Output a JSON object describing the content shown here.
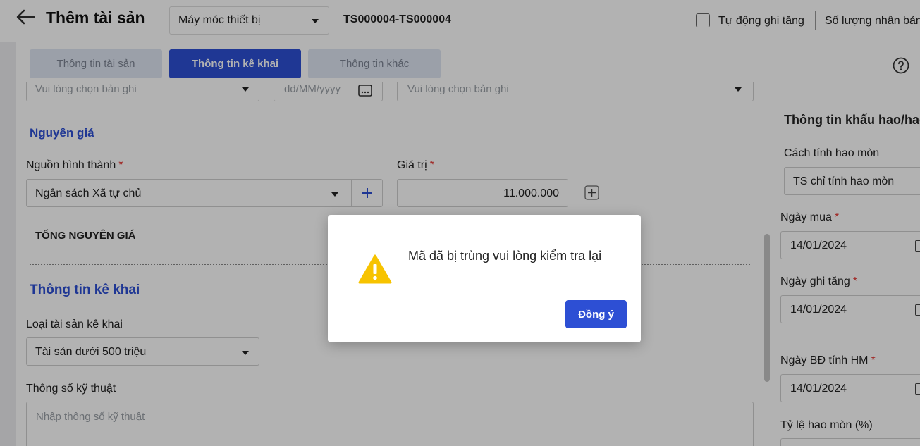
{
  "header": {
    "title": "Thêm tài sản",
    "asset_type": "Máy móc thiết bị",
    "asset_code": "TS000004-TS000004",
    "auto_increase_label": "Tự động ghi tăng",
    "copies_label": "Số lượng nhân bản"
  },
  "tabs": [
    {
      "label": "Thông tin tài sản"
    },
    {
      "label": "Thông tin kê khai"
    },
    {
      "label": "Thông tin khác"
    }
  ],
  "top_row": {
    "record_placeholder": "Vui lòng chọn bản ghi",
    "date_placeholder": "dd/MM/yyyy",
    "record_placeholder_2": "Vui lòng chọn bản ghi"
  },
  "original_cost": {
    "section_title": "Nguyên giá",
    "source_label": "Nguồn hình thành",
    "source_value": "Ngân sách Xã tự chủ",
    "value_label": "Giá trị",
    "value": "11.000.000",
    "total_label": "TỔNG NGUYÊN GIÁ"
  },
  "declaration": {
    "section_title": "Thông tin kê khai",
    "type_label": "Loại tài sản kê khai",
    "type_value": "Tài sản dưới 500 triệu",
    "spec_label": "Thông số kỹ thuật",
    "spec_placeholder": "Nhập thông số kỹ thuật"
  },
  "depreciation": {
    "title": "Thông tin khấu hao/hao",
    "method_label": "Cách tính hao mòn",
    "method_value": "TS chỉ tính hao mòn",
    "purchase_date_label": "Ngày mua",
    "purchase_date": "14/01/2024",
    "increase_date_label": "Ngày ghi tăng",
    "increase_date": "14/01/2024",
    "start_date_label": "Ngày BĐ tính HM",
    "start_date": "14/01/2024",
    "rate_label": "Tỷ lệ hao mòn (%)"
  },
  "dialog": {
    "message": "Mã đã bị trùng vui lòng kiểm tra lại",
    "ok_label": "Đồng ý"
  },
  "colors": {
    "primary": "#2d4fd4",
    "warning": "#f7c300",
    "required": "#e53935"
  }
}
